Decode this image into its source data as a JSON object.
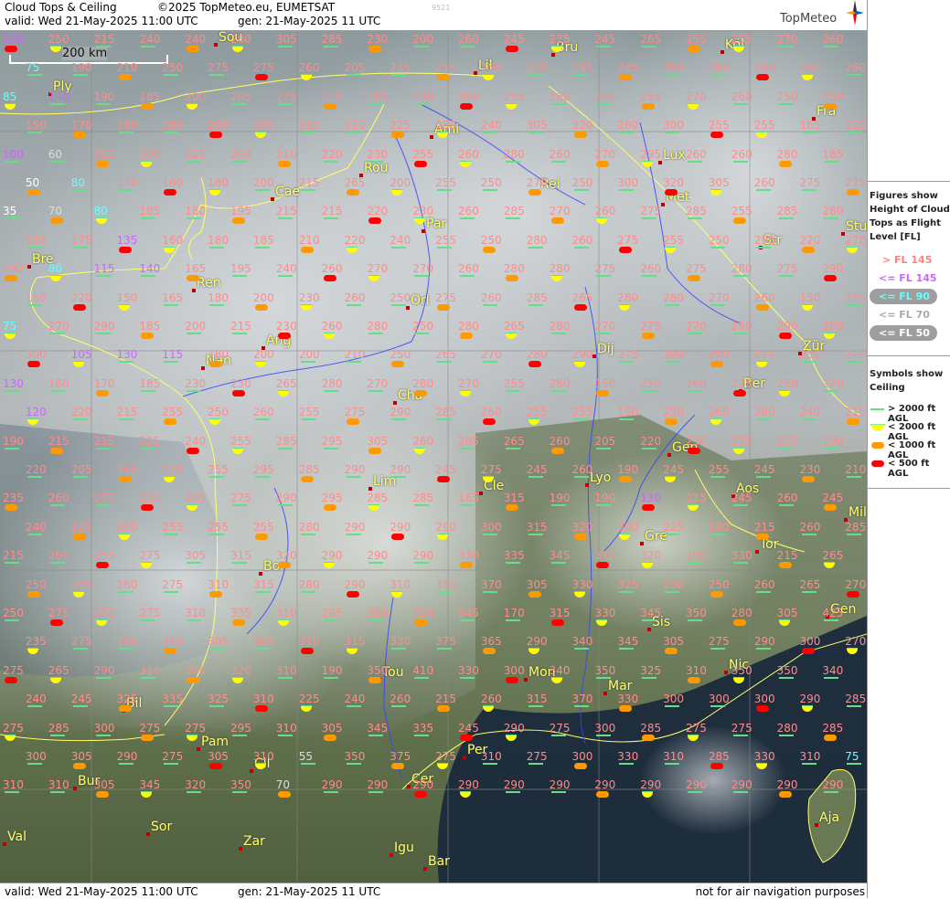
{
  "header": {
    "title": "Cloud Tops & Ceiling",
    "copyright": "©2025 TopMeteo.eu, EUMETSAT",
    "valid": "valid:  Wed  21-May-2025  11:00 UTC",
    "gen": "gen: 21-May-2025 11 UTC",
    "code": "9521",
    "logo": "TopMeteo"
  },
  "footer": {
    "valid": "valid:  Wed  21-May-2025  11:00 UTC",
    "gen": "gen: 21-May-2025 11 UTC",
    "note": "not for air navigation purposes"
  },
  "scale_label": "200 km",
  "legend": {
    "figures_title": [
      "Figures show",
      "Height of Cloud",
      "Tops as Flight",
      "Level  [FL]"
    ],
    "levels": [
      {
        "label": "> FL 145",
        "color": "#ff8080"
      },
      {
        "label": "<= FL 145",
        "color": "#cc66ff"
      },
      {
        "label": "<= FL 90",
        "color": "#66ffff"
      },
      {
        "label": "<= FL 70",
        "color": "#aaaaaa"
      },
      {
        "label": "<= FL 50",
        "color": "#ffffff"
      }
    ],
    "symbols_title": [
      "Symbols show",
      "Ceiling"
    ],
    "symbols": [
      {
        "label": "> 2000 ft AGL",
        "type": "line",
        "color": "#66dd88"
      },
      {
        "label": "< 2000 ft AGL",
        "type": "half",
        "color": "#ffff00"
      },
      {
        "label": "< 1000 ft AGL",
        "type": "pill",
        "color": "#ff9900"
      },
      {
        "label": "< 500 ft AGL",
        "type": "pill",
        "color": "#ff0000"
      }
    ]
  },
  "cities": [
    "Sou",
    "Lil",
    "Bru",
    "Köl",
    "Ply",
    "Ami",
    "Fra",
    "Lux",
    "Rou",
    "Cae",
    "Rei",
    "Met",
    "Par",
    "Str",
    "Stu",
    "Bre",
    "Ren",
    "Orl",
    "Ang",
    "Nan",
    "Dij",
    "Zür",
    "Cha",
    "Ber",
    "Lim",
    "Cle",
    "Gen",
    "Lyo",
    "Aos",
    "Mil",
    "Gre",
    "Tor",
    "Bor",
    "Gen",
    "Sis",
    "Tou",
    "Mon",
    "Mar",
    "Nic",
    "Bil",
    "Pam",
    "Cil",
    "Per",
    "Bur",
    "Cer",
    "Sor",
    "Zar",
    "Igu",
    "Bar",
    "Aja",
    "Val"
  ],
  "city_positions": [
    [
      236,
      49
    ],
    [
      520,
      80
    ],
    [
      605,
      60
    ],
    [
      790,
      57
    ],
    [
      55,
      103
    ],
    [
      472,
      150
    ],
    [
      890,
      130
    ],
    [
      722,
      178
    ],
    [
      395,
      192
    ],
    [
      298,
      218
    ],
    [
      588,
      210
    ],
    [
      725,
      224
    ],
    [
      463,
      253
    ],
    [
      832,
      271
    ],
    [
      922,
      256
    ],
    [
      32,
      292
    ],
    [
      212,
      318
    ],
    [
      446,
      337
    ],
    [
      288,
      381
    ],
    [
      222,
      403
    ],
    [
      650,
      390
    ],
    [
      875,
      387
    ],
    [
      432,
      441
    ],
    [
      810,
      428
    ],
    [
      405,
      535
    ],
    [
      526,
      540
    ],
    [
      732,
      498
    ],
    [
      642,
      531
    ],
    [
      802,
      543
    ],
    [
      925,
      569
    ],
    [
      702,
      595
    ],
    [
      828,
      604
    ],
    [
      285,
      628
    ],
    [
      905,
      675
    ],
    [
      710,
      689
    ],
    [
      415,
      744
    ],
    [
      575,
      744
    ],
    [
      662,
      759
    ],
    [
      794,
      736
    ],
    [
      135,
      778
    ],
    [
      217,
      820
    ],
    [
      275,
      844
    ],
    [
      508,
      829
    ],
    [
      82,
      863
    ],
    [
      447,
      861
    ],
    [
      162,
      913
    ],
    [
      263,
      929
    ],
    [
      428,
      936
    ],
    [
      465,
      951
    ],
    [
      893,
      903
    ],
    [
      5,
      924
    ]
  ],
  "grid_values": [
    [
      "100",
      "250",
      "215",
      "240",
      "240",
      "280",
      "305",
      "285",
      "230",
      "200",
      "260",
      "245",
      "225",
      "245",
      "265",
      "255",
      "255",
      "270",
      "260"
    ],
    [
      "75",
      "190",
      "210",
      "250",
      "275",
      "275",
      "260",
      "205",
      "235",
      "255",
      "250",
      "250",
      "235",
      "245",
      "260",
      "260",
      "260",
      "260",
      "260"
    ],
    [
      "85",
      "140",
      "190",
      "185",
      "200",
      "205",
      "225",
      "215",
      "185",
      "230",
      "300",
      "255",
      "260",
      "255",
      "265",
      "270",
      "260",
      "250",
      "250"
    ],
    [
      "150",
      "170",
      "180",
      "180",
      "200",
      "205",
      "210",
      "220",
      "225",
      "250",
      "240",
      "305",
      "320",
      "260",
      "300",
      "255",
      "255",
      "165",
      "210"
    ],
    [
      "100",
      "60",
      "225",
      "200",
      "215",
      "200",
      "210",
      "220",
      "230",
      "255",
      "260",
      "280",
      "260",
      "270",
      "295",
      "260",
      "260",
      "280",
      "185"
    ],
    [
      "50",
      "80",
      "170",
      "180",
      "180",
      "200",
      "215",
      "265",
      "200",
      "255",
      "250",
      "270",
      "250",
      "300",
      "320",
      "305",
      "260",
      "275",
      "275"
    ],
    [
      "35",
      "70",
      "80",
      "185",
      "180",
      "195",
      "215",
      "215",
      "220",
      "230",
      "260",
      "285",
      "270",
      "260",
      "275",
      "285",
      "255",
      "285",
      "280"
    ],
    [
      "180",
      "175",
      "135",
      "160",
      "180",
      "185",
      "210",
      "220",
      "240",
      "255",
      "250",
      "280",
      "260",
      "275",
      "255",
      "250",
      "290",
      "220",
      "270"
    ],
    [
      "190",
      "80",
      "115",
      "140",
      "165",
      "195",
      "240",
      "260",
      "270",
      "270",
      "260",
      "280",
      "280",
      "275",
      "260",
      "275",
      "280",
      "275",
      "290"
    ],
    [
      "150",
      "220",
      "150",
      "165",
      "180",
      "200",
      "230",
      "260",
      "250",
      "275",
      "260",
      "285",
      "265",
      "280",
      "280",
      "270",
      "260",
      "150",
      "285"
    ],
    [
      "75",
      "270",
      "290",
      "185",
      "200",
      "215",
      "230",
      "260",
      "280",
      "250",
      "280",
      "265",
      "280",
      "270",
      "275",
      "270",
      "280",
      "290",
      "280"
    ],
    [
      "300",
      "105",
      "130",
      "115",
      "180",
      "200",
      "200",
      "210",
      "250",
      "265",
      "270",
      "280",
      "290",
      "275",
      "300",
      "200",
      "275",
      "250",
      "275"
    ],
    [
      "130",
      "180",
      "170",
      "185",
      "230",
      "230",
      "265",
      "280",
      "270",
      "280",
      "270",
      "255",
      "260",
      "150",
      "250",
      "260",
      "275",
      "250",
      "220"
    ],
    [
      "120",
      "220",
      "215",
      "255",
      "250",
      "260",
      "255",
      "275",
      "290",
      "285",
      "260",
      "255",
      "255",
      "150",
      "250",
      "260",
      "280",
      "240",
      "215"
    ],
    [
      "190",
      "215",
      "215",
      "215",
      "240",
      "255",
      "285",
      "295",
      "305",
      "260",
      "205",
      "265",
      "260",
      "205",
      "220",
      "250",
      "270",
      "215",
      "190"
    ],
    [
      "220",
      "205",
      "265",
      "270",
      "255",
      "295",
      "285",
      "290",
      "290",
      "245",
      "275",
      "245",
      "260",
      "190",
      "245",
      "255",
      "245",
      "230",
      "210"
    ],
    [
      "235",
      "260",
      "275",
      "250",
      "265",
      "275",
      "290",
      "295",
      "285",
      "285",
      "165",
      "315",
      "190",
      "190",
      "130",
      "215",
      "245",
      "260",
      "245"
    ],
    [
      "240",
      "265",
      "260",
      "255",
      "255",
      "255",
      "280",
      "290",
      "290",
      "290",
      "300",
      "315",
      "320",
      "300",
      "225",
      "190",
      "215",
      "260",
      "285"
    ],
    [
      "215",
      "265",
      "255",
      "275",
      "305",
      "315",
      "320",
      "290",
      "290",
      "290",
      "330",
      "335",
      "345",
      "310",
      "320",
      "260",
      "330",
      "215",
      "265"
    ],
    [
      "250",
      "265",
      "260",
      "275",
      "310",
      "315",
      "280",
      "290",
      "310",
      "310",
      "370",
      "305",
      "330",
      "325",
      "230",
      "250",
      "260",
      "265",
      "270"
    ],
    [
      "250",
      "275",
      "275",
      "275",
      "310",
      "335",
      "310",
      "295",
      "300",
      "320",
      "345",
      "170",
      "315",
      "330",
      "345",
      "350",
      "280",
      "305",
      "425"
    ],
    [
      "235",
      "275",
      "280",
      "310",
      "305",
      "305",
      "310",
      "315",
      "330",
      "375",
      "365",
      "290",
      "340",
      "345",
      "305",
      "275",
      "290",
      "300",
      "270"
    ],
    [
      "275",
      "265",
      "290",
      "310",
      "305",
      "320",
      "310",
      "190",
      "350",
      "410",
      "330",
      "300",
      "340",
      "350",
      "325",
      "310",
      "350",
      "350",
      "340"
    ],
    [
      "240",
      "245",
      "325",
      "335",
      "325",
      "310",
      "225",
      "240",
      "260",
      "215",
      "260",
      "315",
      "370",
      "330",
      "300",
      "300",
      "300",
      "290",
      "285"
    ],
    [
      "275",
      "285",
      "300",
      "275",
      "275",
      "295",
      "310",
      "305",
      "345",
      "335",
      "245",
      "290",
      "275",
      "300",
      "285",
      "275",
      "275",
      "280",
      "285"
    ],
    [
      "300",
      "305",
      "290",
      "275",
      "305",
      "310",
      "55",
      "350",
      "375",
      "275",
      "310",
      "275",
      "300",
      "330",
      "310",
      "285",
      "330",
      "310",
      "75"
    ],
    [
      "310",
      "310",
      "305",
      "345",
      "320",
      "350",
      "70",
      "290",
      "290",
      "290",
      "290",
      "290",
      "290",
      "290",
      "290",
      "290",
      "290",
      "290",
      "290"
    ]
  ]
}
